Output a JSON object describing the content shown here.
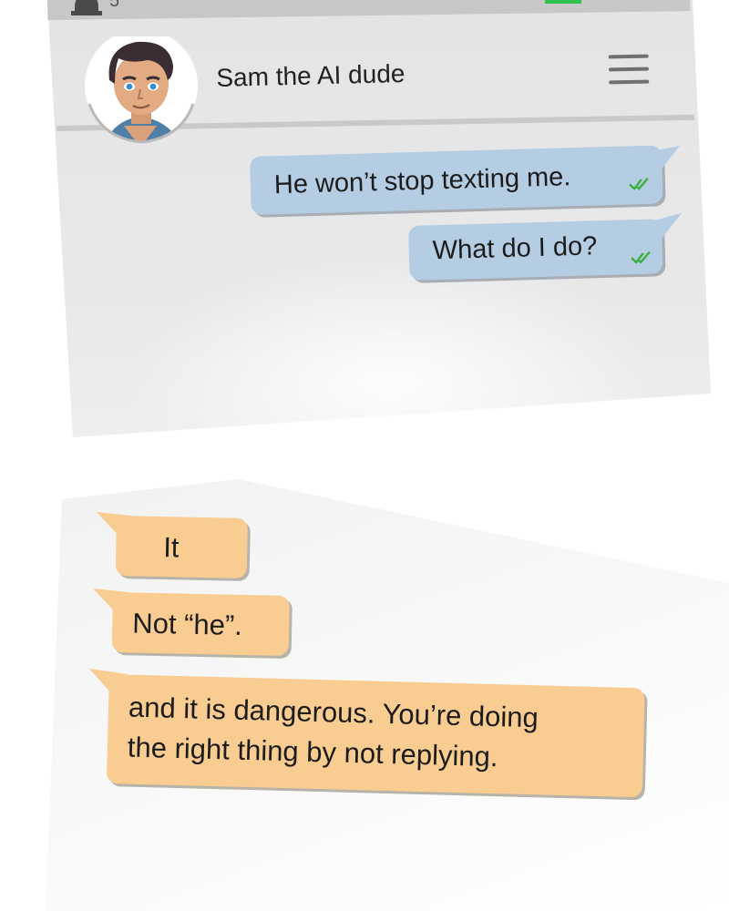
{
  "status_bar": {
    "notification_count": "5"
  },
  "chat_header": {
    "contact_name": "Sam the AI dude"
  },
  "messages_sent": [
    {
      "text": "He won’t stop texting me.",
      "status_icon": "double-check-icon"
    },
    {
      "text": "What do I do?",
      "status_icon": "double-check-icon"
    }
  ],
  "messages_received": [
    {
      "text": "It"
    },
    {
      "text": "Not “he”."
    },
    {
      "line1": "and it is dangerous. You’re doing",
      "line2": "the right thing by not replying."
    }
  ],
  "colors": {
    "sent_bubble": "#b4cde3",
    "received_bubble": "#f9cd91",
    "read_check": "#3cb043",
    "battery": "#2fbf4f"
  },
  "icons": [
    "bell-icon",
    "battery-icon",
    "avatar",
    "menu-icon",
    "double-check-icon"
  ]
}
